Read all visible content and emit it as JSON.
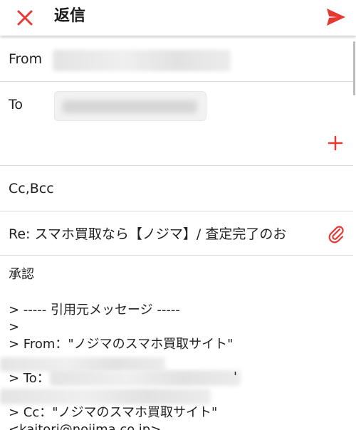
{
  "header": {
    "title": "返信",
    "close_icon": "close-icon",
    "send_icon": "send-icon",
    "accent_color": "#e53935"
  },
  "from": {
    "label": "From"
  },
  "to": {
    "label": "To",
    "add_icon": "plus-icon"
  },
  "cc": {
    "label": "Cc,Bcc"
  },
  "subject": {
    "text": "Re: スマホ買取なら【ノジマ】/ 査定完了のお",
    "attach_icon": "paperclip-icon"
  },
  "body": {
    "lines": [
      "承認",
      "> ----- 引用元メッセージ -----",
      ">",
      "> From：\"ノジマのスマホ買取サイト\"",
      "> To：",
      "'",
      "> Cc：\"ノジマのスマホ買取サイト\"",
      "<kaitori@nojima.co.jp>"
    ]
  }
}
